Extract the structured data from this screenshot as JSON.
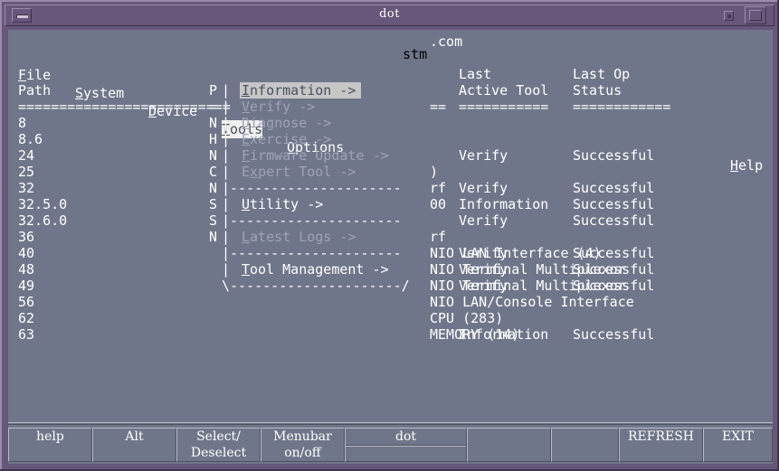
{
  "window": {
    "title": "dot",
    "buttons": {
      "minimize": "minimize-button",
      "restore": "restore-button",
      "maximize": "maximize-button"
    }
  },
  "app": {
    "banner": "stm"
  },
  "menubar": {
    "items": [
      {
        "label": "File",
        "mnemonic": "F",
        "selected": false
      },
      {
        "label": "System",
        "mnemonic": "S",
        "selected": false
      },
      {
        "label": "Device",
        "mnemonic": "D",
        "selected": false
      },
      {
        "label": "Tools",
        "mnemonic": "T",
        "selected": true
      },
      {
        "label": "Options",
        "mnemonic": "O",
        "selected": false
      }
    ],
    "help": {
      "label": "Help",
      "mnemonic": "H"
    }
  },
  "tools_menu": {
    "open": true,
    "items": [
      {
        "label": "Information ->",
        "mnemonic": "I",
        "state": "highlighted"
      },
      {
        "label": "Verify ->",
        "mnemonic": "V",
        "state": "disabled"
      },
      {
        "label": "Diagnose ->",
        "mnemonic": "D",
        "state": "disabled"
      },
      {
        "label": "Exercise ->",
        "mnemonic": "E",
        "state": "disabled"
      },
      {
        "label": "Firmware Update ->",
        "mnemonic": "F",
        "state": "disabled"
      },
      {
        "label": "Expert Tool ->",
        "mnemonic": "x",
        "state": "disabled"
      },
      {
        "label": "---------------------",
        "state": "separator"
      },
      {
        "label": "Utility ->",
        "mnemonic": "U",
        "state": "enabled"
      },
      {
        "label": "---------------------",
        "state": "separator"
      },
      {
        "label": "Latest Logs ->",
        "mnemonic": "L",
        "state": "disabled"
      },
      {
        "label": "---------------------",
        "state": "separator"
      },
      {
        "label": "Tool Management ->",
        "mnemonic": "T",
        "state": "enabled"
      },
      {
        "label": "\\---------------------/",
        "state": "bottom-border"
      }
    ]
  },
  "table": {
    "headers": {
      "path": "Path",
      "product": "P",
      "last_active_tool_line1": "Last",
      "last_active_tool_line2": "Active Tool",
      "last_op_status_line1": "Last Op",
      "last_op_status_line2": "Status"
    },
    "rules": {
      "path_rule": "==========================",
      "mid_rule": "==",
      "tool_rule": "===========",
      "status_rule": "============"
    },
    "rows": [
      {
        "path": "8",
        "occluded": "N",
        "desc": "",
        "tool": "",
        "status": ""
      },
      {
        "path": "8.6",
        "occluded": "H",
        "desc": "",
        "tool": "",
        "status": ""
      },
      {
        "path": "24",
        "occluded": "N",
        "desc": "",
        "tool": "Verify",
        "status": "Successful"
      },
      {
        "path": "25",
        "occluded": "C",
        "desc": ")",
        "tool": "",
        "status": ""
      },
      {
        "path": "32",
        "occluded": "N",
        "desc": "rf",
        "tool": "Verify",
        "status": "Successful"
      },
      {
        "path": "32.5.0",
        "occluded": "S",
        "desc": "00",
        "tool": "Information",
        "status": "Successful"
      },
      {
        "path": "32.6.0",
        "occluded": "S",
        "desc": "",
        "tool": "Verify",
        "status": "Successful"
      },
      {
        "path": "36",
        "occluded": "N",
        "desc": "rf",
        "tool": "",
        "status": ""
      },
      {
        "path": "40",
        "occluded": "",
        "desc": "NIO LAN Interface (4)",
        "tool": "Verify",
        "status": "Successful"
      },
      {
        "path": "48",
        "occluded": "",
        "desc": "NIO Terminal Multiplexor",
        "tool": "Verify",
        "status": "Successful"
      },
      {
        "path": "49",
        "occluded": "",
        "desc": "NIO Terminal Multiplexor",
        "tool": "Verify",
        "status": "Successful"
      },
      {
        "path": "56",
        "occluded": "",
        "desc": "NIO LAN/Console Interface",
        "tool": "",
        "status": ""
      },
      {
        "path": "62",
        "occluded": "",
        "desc": "CPU (283)",
        "tool": "",
        "status": ""
      },
      {
        "path": "63",
        "occluded": "",
        "desc": "MEMORY (14)",
        "tool": "Information",
        "status": "Successful"
      }
    ],
    "partial_right": ".com"
  },
  "function_keys": [
    {
      "line1": "",
      "line2": "help",
      "name": "help"
    },
    {
      "line1": "",
      "line2": "Alt",
      "name": "alt"
    },
    {
      "line1": "Select/",
      "line2": "Deselect",
      "name": "select-deselect"
    },
    {
      "line1": "Menubar",
      "line2": "on/off",
      "name": "menubar-on-off"
    },
    {
      "line1": "dot",
      "line2": "",
      "name": "dot",
      "split": true
    },
    {
      "line1": "",
      "line2": "",
      "name": "blank-1"
    },
    {
      "line1": "",
      "line2": "",
      "name": "blank-2"
    },
    {
      "line1": "",
      "line2": "REFRESH",
      "name": "refresh"
    },
    {
      "line1": "",
      "line2": "EXIT",
      "name": "exit"
    }
  ],
  "colors": {
    "titlebar": "#67577a",
    "titlebar_highlight": "#9b8bab",
    "titlebar_shadow": "#3f3350",
    "terminal_bg": "#70768a",
    "text": "#ffffff",
    "disabled_text": "#9ea4b4",
    "menu_selected_bg": "#f0f0f0",
    "popup_highlight_bg": "#c6c6c6"
  }
}
